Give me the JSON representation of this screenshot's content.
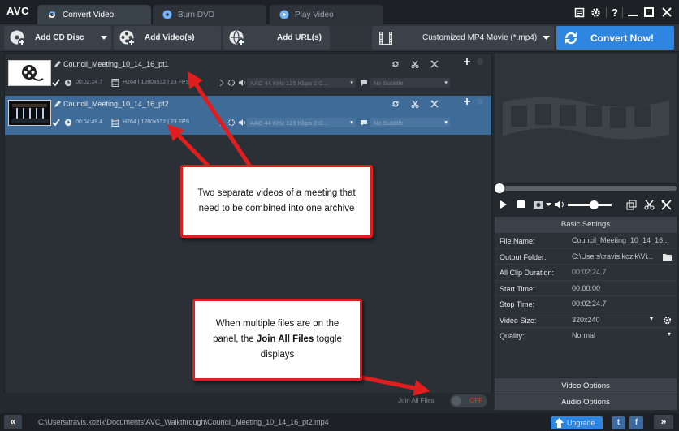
{
  "app": {
    "logo": "AVC"
  },
  "tabs": [
    {
      "label": "Convert Video",
      "active": true,
      "icon": "convert-icon"
    },
    {
      "label": "Burn DVD",
      "active": false,
      "icon": "disc-icon"
    },
    {
      "label": "Play Video",
      "active": false,
      "icon": "play-icon"
    }
  ],
  "window": {
    "help": "?"
  },
  "toolbar": {
    "add_cd_label": "Add CD Disc",
    "add_videos_label": "Add Video(s)",
    "add_url_label": "Add URL(s)",
    "profile_label": "Customized MP4 Movie (*.mp4)",
    "convert_label": "Convert Now!"
  },
  "files": [
    {
      "name": "Council_Meeting_10_14_16_pt1",
      "duration": "00:02:24.7",
      "video_info": "H264 | 1280x532 | 23 FPS",
      "audio": "AAC 44 KHz 125 Kbps 2 C...",
      "subtitle": "No Subtitle",
      "selected": false
    },
    {
      "name": "Council_Meeting_10_14_16_pt2",
      "duration": "00:04:49.4",
      "video_info": "H264 | 1280x532 | 23 FPS",
      "audio": "AAC 44 KHz 125 Kbps 2 C...",
      "subtitle": "No Subtitle",
      "selected": true
    }
  ],
  "join": {
    "label": "Join All Files",
    "state": "OFF"
  },
  "settings": {
    "header": "Basic Settings",
    "rows": [
      {
        "key": "File Name:",
        "value": "Council_Meeting_10_14_16..."
      },
      {
        "key": "Output Folder:",
        "value": "C:\\Users\\travis.kozik\\Vi..."
      },
      {
        "key": "All Clip Duration:",
        "value": "00:02:24.7"
      },
      {
        "key": "Start Time:",
        "value": "00:00:00"
      },
      {
        "key": "Stop Time:",
        "value": "00:02:24.7"
      },
      {
        "key": "Video Size:",
        "value": "320x240"
      },
      {
        "key": "Quality:",
        "value": "Normal"
      }
    ],
    "video_options": "Video Options",
    "audio_options": "Audio Options"
  },
  "status": {
    "path": "C:\\Users\\travis.kozik\\Documents\\AVC_Walkthrough\\Council_Meeting_10_14_16_pt2.mp4",
    "upgrade_label": "Upgrade",
    "collapse": "«",
    "expand": "»"
  },
  "annotations": {
    "callout1": "Two separate videos of a meeting that need to be combined into one archive",
    "callout2_pre": "When multiple files are on the panel, the ",
    "callout2_bold": "Join All Files",
    "callout2_post": " toggle displays"
  },
  "colors": {
    "accent": "#2f86e0",
    "callout_border": "#e21d1d",
    "selected_row": "#3f6b99"
  }
}
